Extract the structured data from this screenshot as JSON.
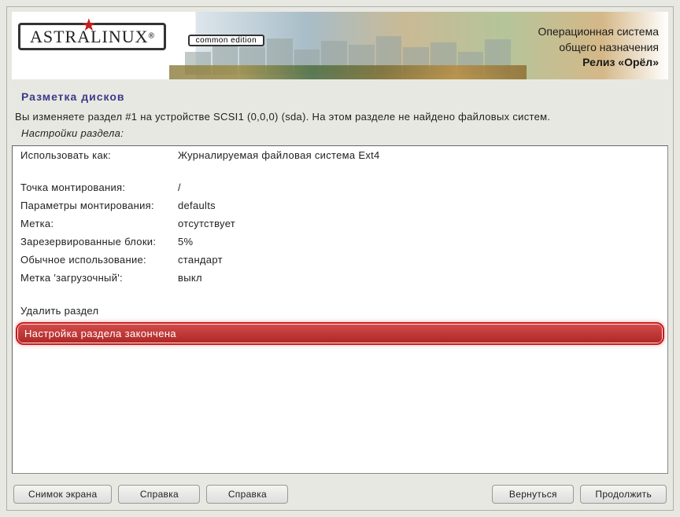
{
  "header": {
    "brand_main": "ASTRALINUX",
    "brand_sub": "common edition",
    "os_line1": "Операционная система",
    "os_line2": "общего назначения",
    "release": "Релиз «Орёл»"
  },
  "title": "Разметка дисков",
  "instruction": "Вы изменяете раздел #1 на устройстве SCSI1 (0,0,0) (sda). На этом разделе не найдено файловых систем.",
  "sub_instruction": "Настройки раздела:",
  "settings": [
    {
      "label": "Использовать как:",
      "value": "Журналируемая файловая система Ext4"
    },
    {},
    {
      "label": "Точка монтирования:",
      "value": "/"
    },
    {
      "label": "Параметры монтирования:",
      "value": "defaults"
    },
    {
      "label": "Метка:",
      "value": "отсутствует"
    },
    {
      "label": "Зарезервированные блоки:",
      "value": "5%"
    },
    {
      "label": "Обычное использование:",
      "value": "стандарт"
    },
    {
      "label": "Метка 'загрузочный':",
      "value": "выкл"
    }
  ],
  "actions": {
    "delete": "Удалить раздел",
    "done": "Настройка раздела закончена"
  },
  "buttons": {
    "screenshot": "Снимок экрана",
    "help1": "Справка",
    "help2": "Справка",
    "back": "Вернуться",
    "continue": "Продолжить"
  }
}
